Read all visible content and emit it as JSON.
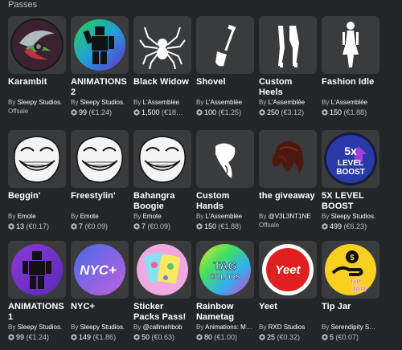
{
  "section": {
    "title": "Passes"
  },
  "creator_prefix": "By",
  "items": [
    {
      "name": "Karambit",
      "creator": "Sleepy Studios.",
      "status": "Offsale",
      "icon": "karambit-knife-icon"
    },
    {
      "name": "ANIMATIONS 2",
      "creator": "Sleepy Studios.",
      "price": "99",
      "price_eur": "(€1.24)",
      "icon": "animation-figure-icon"
    },
    {
      "name": "Black Widow",
      "creator": "L'Assemblée",
      "price": "1,500",
      "price_eur": "(€18…",
      "icon": "spider-icon"
    },
    {
      "name": "Shovel",
      "creator": "L'Assemblée",
      "price": "100",
      "price_eur": "(€1.25)",
      "icon": "shovel-icon"
    },
    {
      "name": "Custom Heels",
      "creator": "L'Assemblée",
      "price": "250",
      "price_eur": "(€3.12)",
      "icon": "heels-icon"
    },
    {
      "name": "Fashion Idle",
      "creator": "L'Assemblée",
      "price": "150",
      "price_eur": "(€1.88)",
      "icon": "fashion-figure-icon"
    },
    {
      "name": "Beggin'",
      "creator": "Emote",
      "price": "13",
      "price_eur": "(€0.17)",
      "icon": "trollface-icon"
    },
    {
      "name": "Freestylin'",
      "creator": "Emote",
      "price": "7",
      "price_eur": "(€0.09)",
      "icon": "trollface-icon"
    },
    {
      "name": "Bahangra Boogie",
      "creator": "Emote",
      "price": "7",
      "price_eur": "(€0.09)",
      "icon": "trollface-icon"
    },
    {
      "name": "Custom Hands",
      "creator": "L'Assemblée",
      "price": "150",
      "price_eur": "(€1.88)",
      "icon": "hands-icon"
    },
    {
      "name": "the giveaway",
      "creator": "@V3L3NT1NE",
      "status": "Offsale",
      "icon": "hair-icon"
    },
    {
      "name": "5X LEVEL BOOST",
      "creator": "Sleepy Studios.",
      "price": "499",
      "price_eur": "(€6.23)",
      "icon": "level-boost-icon",
      "thumb_text": [
        "5x",
        "LEVEL",
        "BOOST"
      ]
    },
    {
      "name": "ANIMATIONS 1",
      "creator": "Sleepy Studios.",
      "price": "99",
      "price_eur": "(€1.24)",
      "icon": "animation-figure-icon"
    },
    {
      "name": "NYC+",
      "creator": "Sleepy Studios.",
      "price": "149",
      "price_eur": "(€1.86)",
      "icon": "nyc-plus-icon",
      "thumb_text": [
        "NYC+"
      ]
    },
    {
      "name": "Sticker Packs Pass!",
      "creator": "@callmehbob",
      "price": "50",
      "price_eur": "(€0.63)",
      "icon": "sticker-pack-icon"
    },
    {
      "name": "Rainbow Nametag",
      "creator": "Animations: M…",
      "price": "80",
      "price_eur": "(€1.00)",
      "icon": "rainbow-tag-icon",
      "thumb_text": [
        "TAG",
        "COLORS"
      ]
    },
    {
      "name": "Yeet",
      "creator": "RXD Studios",
      "price": "25",
      "price_eur": "(€0.32)",
      "icon": "yeet-icon",
      "thumb_text": [
        "Yeet"
      ]
    },
    {
      "name": "Tip Jar",
      "creator": "Serendipity S…",
      "price": "5",
      "price_eur": "(€0.07)",
      "icon": "tip-jar-icon",
      "thumb_text": [
        "$",
        "TIP",
        "JAR"
      ]
    }
  ],
  "colors": {
    "background": "#232527",
    "tile": "#393b3d",
    "muted": "#bdbebe"
  }
}
